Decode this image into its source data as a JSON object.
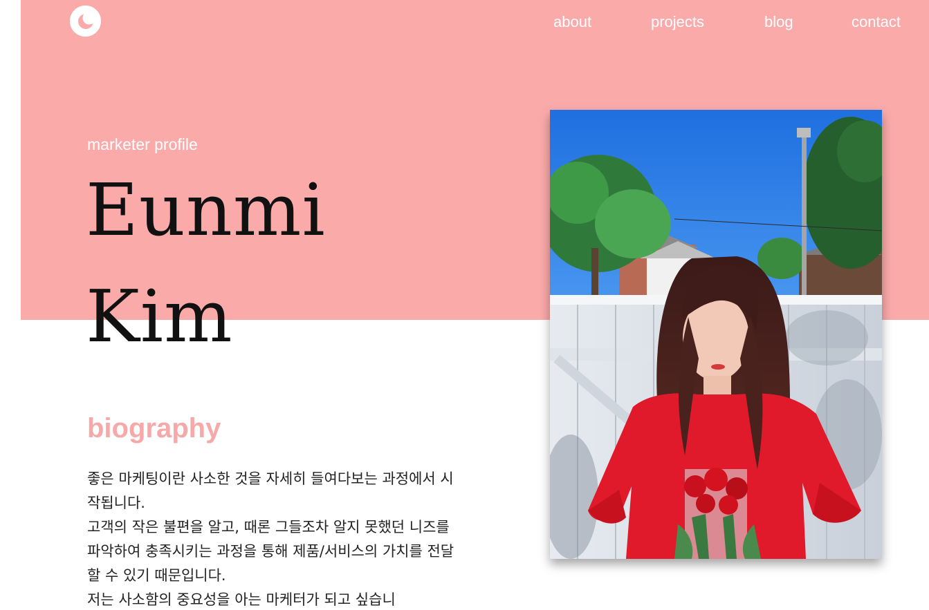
{
  "nav": {
    "items": [
      {
        "label": "about"
      },
      {
        "label": "projects"
      },
      {
        "label": "blog"
      },
      {
        "label": "contact"
      }
    ]
  },
  "logo": {
    "icon": "crescent-moon-icon"
  },
  "hero": {
    "subtitle": "marketer profile",
    "first_name": "Eunmi",
    "last_name": "Kim"
  },
  "biography": {
    "heading": "biography",
    "paragraphs": [
      "좋은 마케팅이란 사소한 것을 자세히 들여다보는 과정에서 시작됩니다.",
      "고객의 작은 불편을 알고, 때론 그들조차 알지 못했던 니즈를 파악하여 충족시키는 과정을 통해 제품/서비스의 가치를 전달할 수 있기 때문입니다.",
      "저는 사소함의 중요성을 아는 마케터가 되고 싶습니"
    ]
  },
  "colors": {
    "hero_background": "#fbaaaa",
    "accent": "#f7a8a8",
    "text": "#111111",
    "white": "#ffffff"
  }
}
